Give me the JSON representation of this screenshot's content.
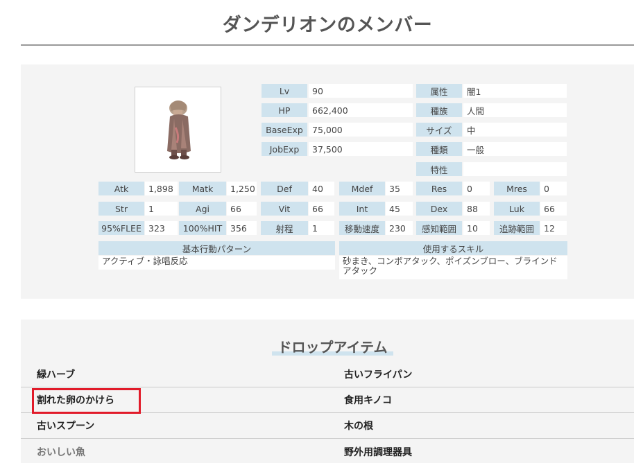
{
  "page": {
    "title": "ダンデリオンのメンバー"
  },
  "monster": {
    "image_alt": "monster-sprite",
    "main_stats": [
      {
        "label": "Lv",
        "value": "90"
      },
      {
        "label": "HP",
        "value": "662,400"
      },
      {
        "label": "BaseExp",
        "value": "75,000"
      },
      {
        "label": "JobExp",
        "value": "37,500"
      }
    ],
    "attributes": [
      {
        "label": "属性",
        "value": "闇1"
      },
      {
        "label": "種族",
        "value": "人間"
      },
      {
        "label": "サイズ",
        "value": "中"
      },
      {
        "label": "種類",
        "value": "一般"
      },
      {
        "label": "特性",
        "value": ""
      }
    ],
    "grid": [
      [
        {
          "label": "Atk",
          "value": "1,898"
        },
        {
          "label": "Matk",
          "value": "1,250"
        },
        {
          "label": "Def",
          "value": "40"
        },
        {
          "label": "Mdef",
          "value": "35"
        },
        {
          "label": "Res",
          "value": "0"
        },
        {
          "label": "Mres",
          "value": "0"
        }
      ],
      [
        {
          "label": "Str",
          "value": "1"
        },
        {
          "label": "Agi",
          "value": "66"
        },
        {
          "label": "Vit",
          "value": "66"
        },
        {
          "label": "Int",
          "value": "45"
        },
        {
          "label": "Dex",
          "value": "88"
        },
        {
          "label": "Luk",
          "value": "66"
        }
      ],
      [
        {
          "label": "95%FLEE",
          "value": "323"
        },
        {
          "label": "100%HIT",
          "value": "356"
        },
        {
          "label": "射程",
          "value": "1"
        },
        {
          "label": "移動速度",
          "value": "230"
        },
        {
          "label": "感知範囲",
          "value": "10"
        },
        {
          "label": "追跡範囲",
          "value": "12"
        }
      ]
    ],
    "behavior": {
      "header": "基本行動パターン",
      "text": "アクティブ・詠唱反応"
    },
    "skills": {
      "header": "使用するスキル",
      "text": "砂まき、コンボアタック、ポイズンブロー、ブラインドアタック"
    }
  },
  "drops": {
    "title": "ドロップアイテム",
    "left": [
      "緑ハーブ",
      "割れた卵のかけら",
      "古いスプーン",
      "おいしい魚"
    ],
    "right": [
      "古いフライパン",
      "食用キノコ",
      "木の根",
      "野外用調理器具"
    ]
  },
  "colors": {
    "label_bg": "#cfe3ee",
    "panel_bg": "#f4f4f4",
    "highlight": "#e11b2a"
  }
}
